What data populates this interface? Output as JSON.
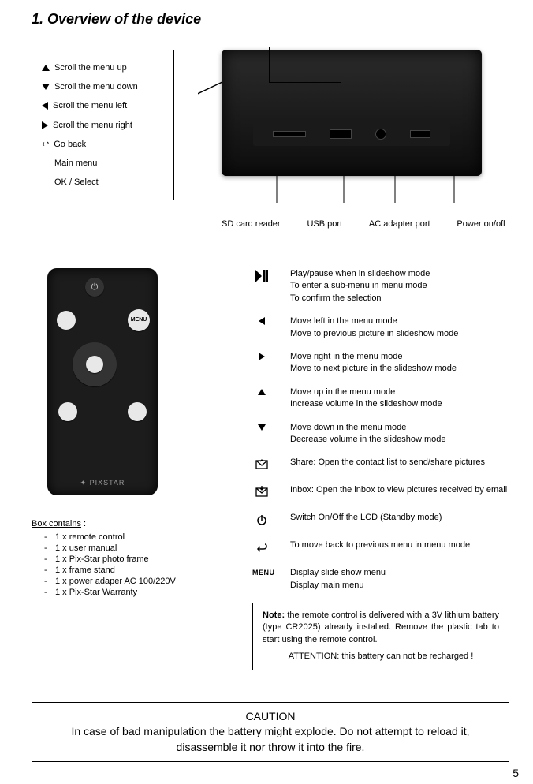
{
  "title": "1. Overview of the device",
  "key_legend": {
    "scroll_up": "Scroll the menu up",
    "scroll_down": "Scroll the menu down",
    "scroll_left": "Scroll the menu left",
    "scroll_right": "Scroll the menu right",
    "go_back": "Go back",
    "main_menu": "Main menu",
    "ok_select": "OK / Select"
  },
  "ports": {
    "sd": "SD card reader",
    "usb": "USB port",
    "ac": "AC adapter port",
    "power": "Power on/off"
  },
  "functions": {
    "play_pause": "Play/pause when in slideshow mode\nTo enter a sub-menu in menu mode\nTo confirm the selection",
    "move_left": "Move left in the menu mode\nMove to previous picture in slideshow mode",
    "move_right": "Move right in the menu mode\nMove to next picture in the slideshow mode",
    "move_up": "Move up in the menu mode\nIncrease volume in the slideshow mode",
    "move_down": "Move down in the menu mode\nDecrease volume in the slideshow mode",
    "share": "Share: Open the contact list to send/share pictures",
    "inbox": "Inbox: Open the inbox to view pictures received by email",
    "power": "Switch On/Off the LCD (Standby mode)",
    "back": "To move back to previous menu in menu mode",
    "menu": "Display slide show menu\nDisplay main menu"
  },
  "box_contains": {
    "header": "Box contains",
    "items": [
      "1 x remote control",
      "1 x user manual",
      "1 x Pix-Star photo frame",
      "1 x frame stand",
      "1 x power adaper AC 100/220V",
      "1 x Pix-Star Warranty"
    ]
  },
  "note": {
    "label": "Note:",
    "body": "the remote control is delivered with a 3V lithium battery (type CR2025) already installed. Remove the plastic tab to start using the remote control.",
    "attention": "ATTENTION: this battery can not be recharged !"
  },
  "caution": {
    "header": "CAUTION",
    "body": "In case of bad manipulation the battery might explode. Do not attempt to reload it, disassemble it nor throw it into the fire."
  },
  "page_number": "5",
  "menu_word": "MENU"
}
